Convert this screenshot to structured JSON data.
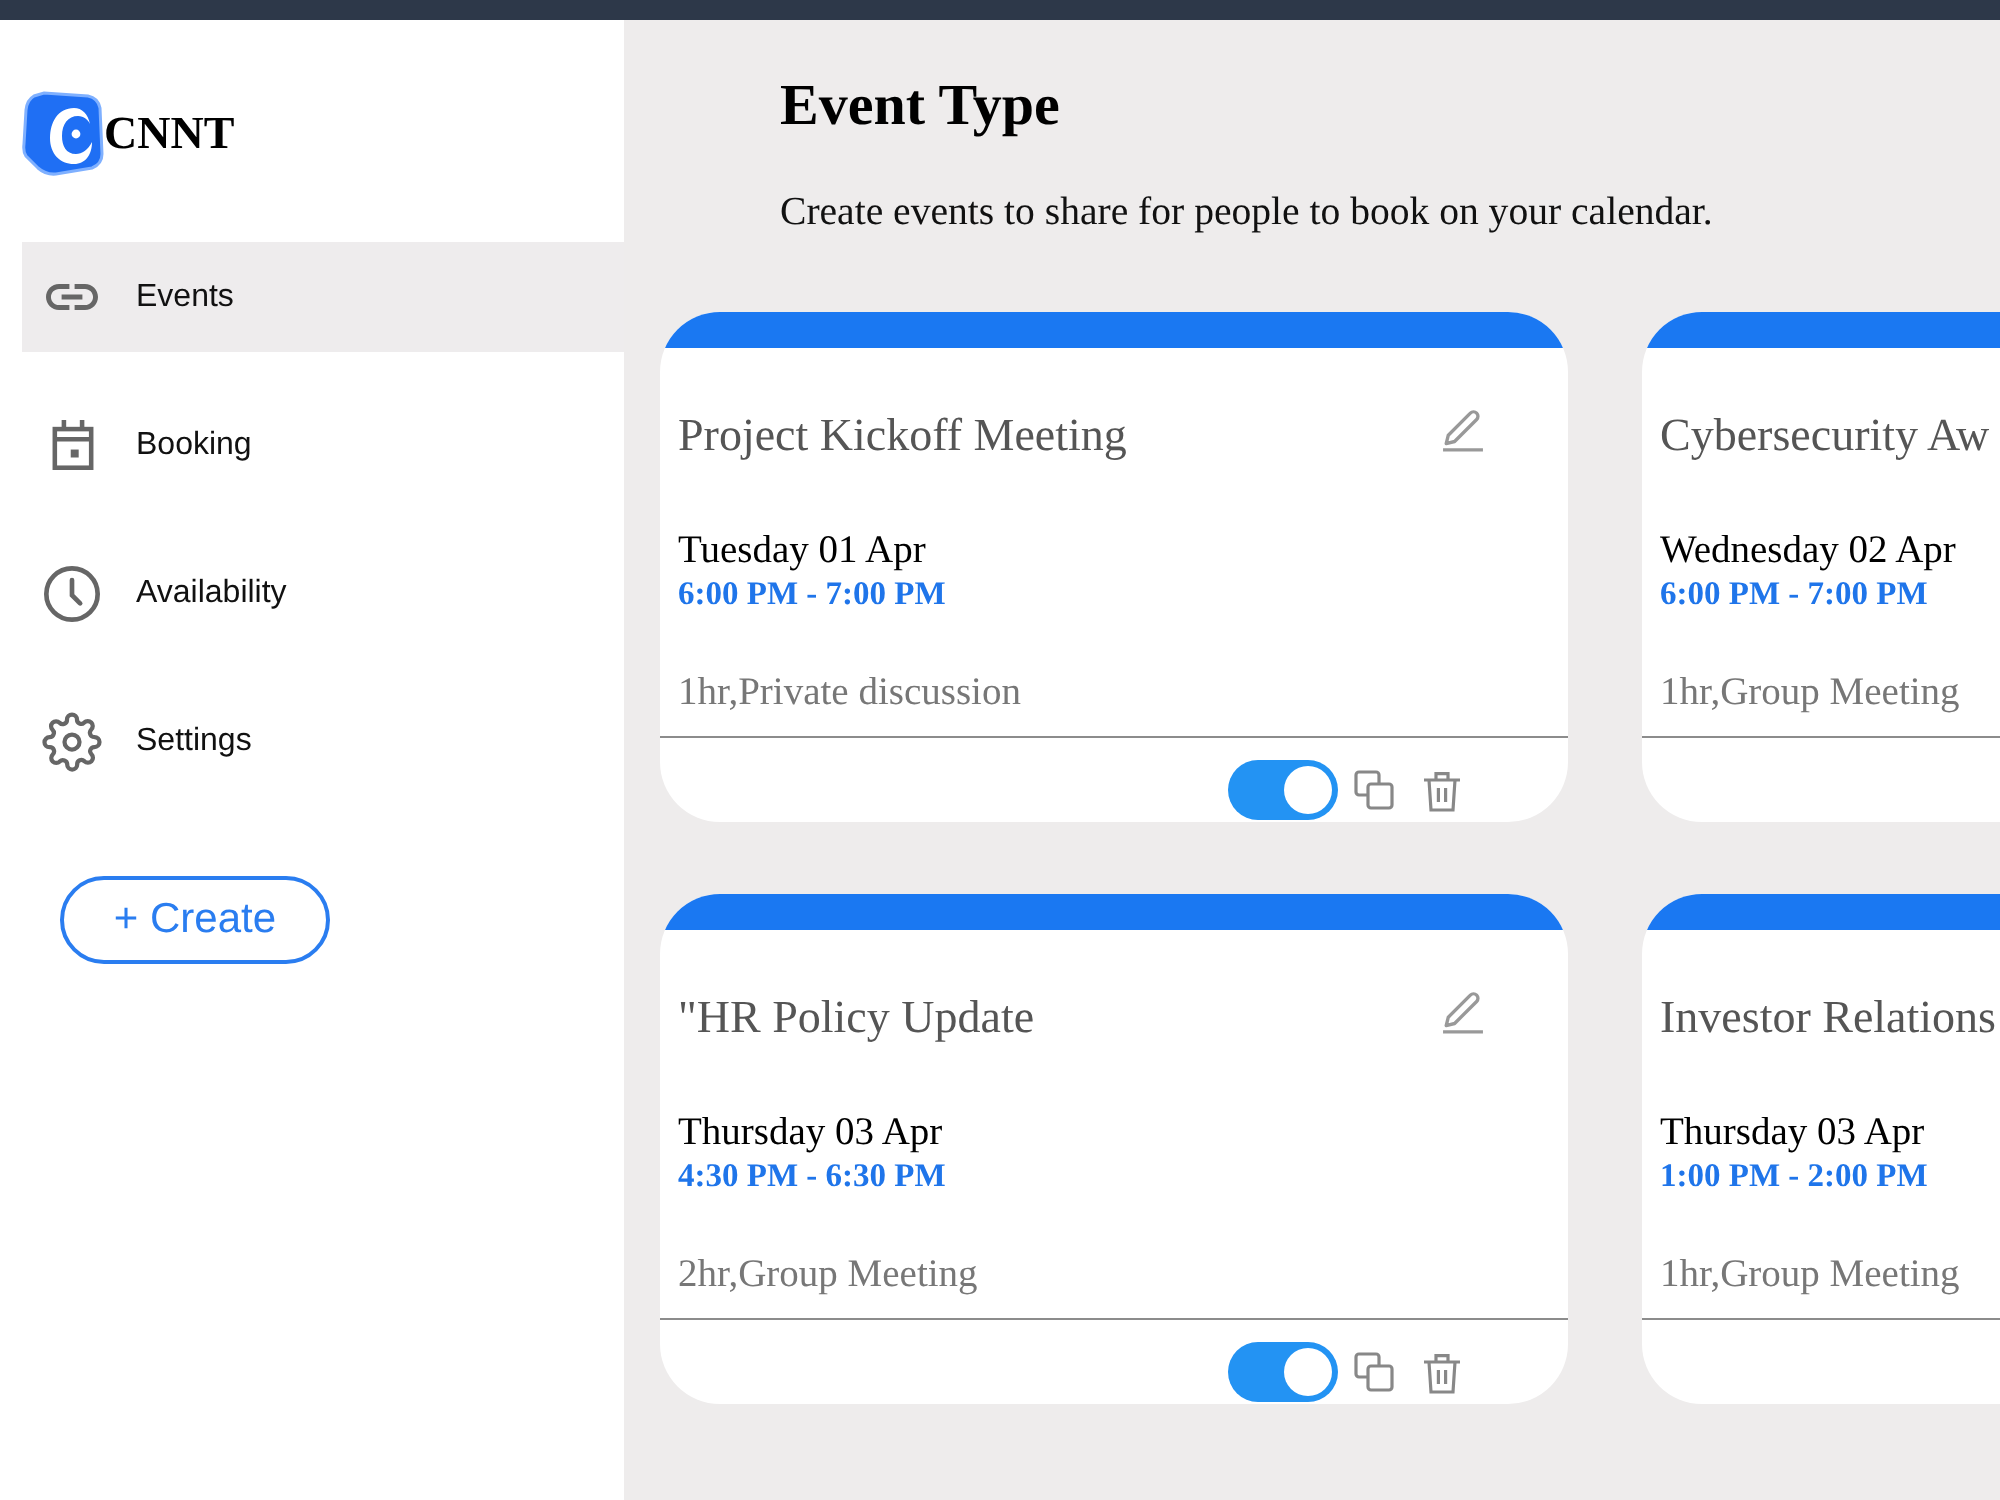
{
  "logo": {
    "text": "CNNT"
  },
  "sidebar": {
    "items": [
      {
        "label": "Events",
        "selected": true
      },
      {
        "label": "Booking",
        "selected": false
      },
      {
        "label": "Availability",
        "selected": false
      },
      {
        "label": "Settings",
        "selected": false
      }
    ]
  },
  "create_button": {
    "label": "+ Create"
  },
  "header": {
    "title": "Event Type",
    "subtitle": "Create events to share for people to book on your calendar."
  },
  "cards": [
    {
      "kind": "full",
      "title": "Project Kickoff Meeting",
      "date": "Tuesday 01 Apr",
      "time": "6:00 PM - 7:00 PM",
      "details": "1hr,Private discussion",
      "enabled": true
    },
    {
      "kind": "cropped",
      "title": "Cybersecurity Aw",
      "date": "Wednesday 02 Apr",
      "time": "6:00 PM - 7:00 PM",
      "details": "1hr,Group Meeting"
    },
    {
      "kind": "full",
      "title": "\"HR Policy Update",
      "date": "Thursday 03 Apr",
      "time": "4:30 PM - 6:30 PM",
      "details": "2hr,Group Meeting",
      "enabled": true
    },
    {
      "kind": "cropped",
      "title": "Investor Relations",
      "date": "Thursday 03 Apr",
      "time": "1:00 PM - 2:00 PM",
      "details": "1hr,Group Meeting"
    }
  ]
}
